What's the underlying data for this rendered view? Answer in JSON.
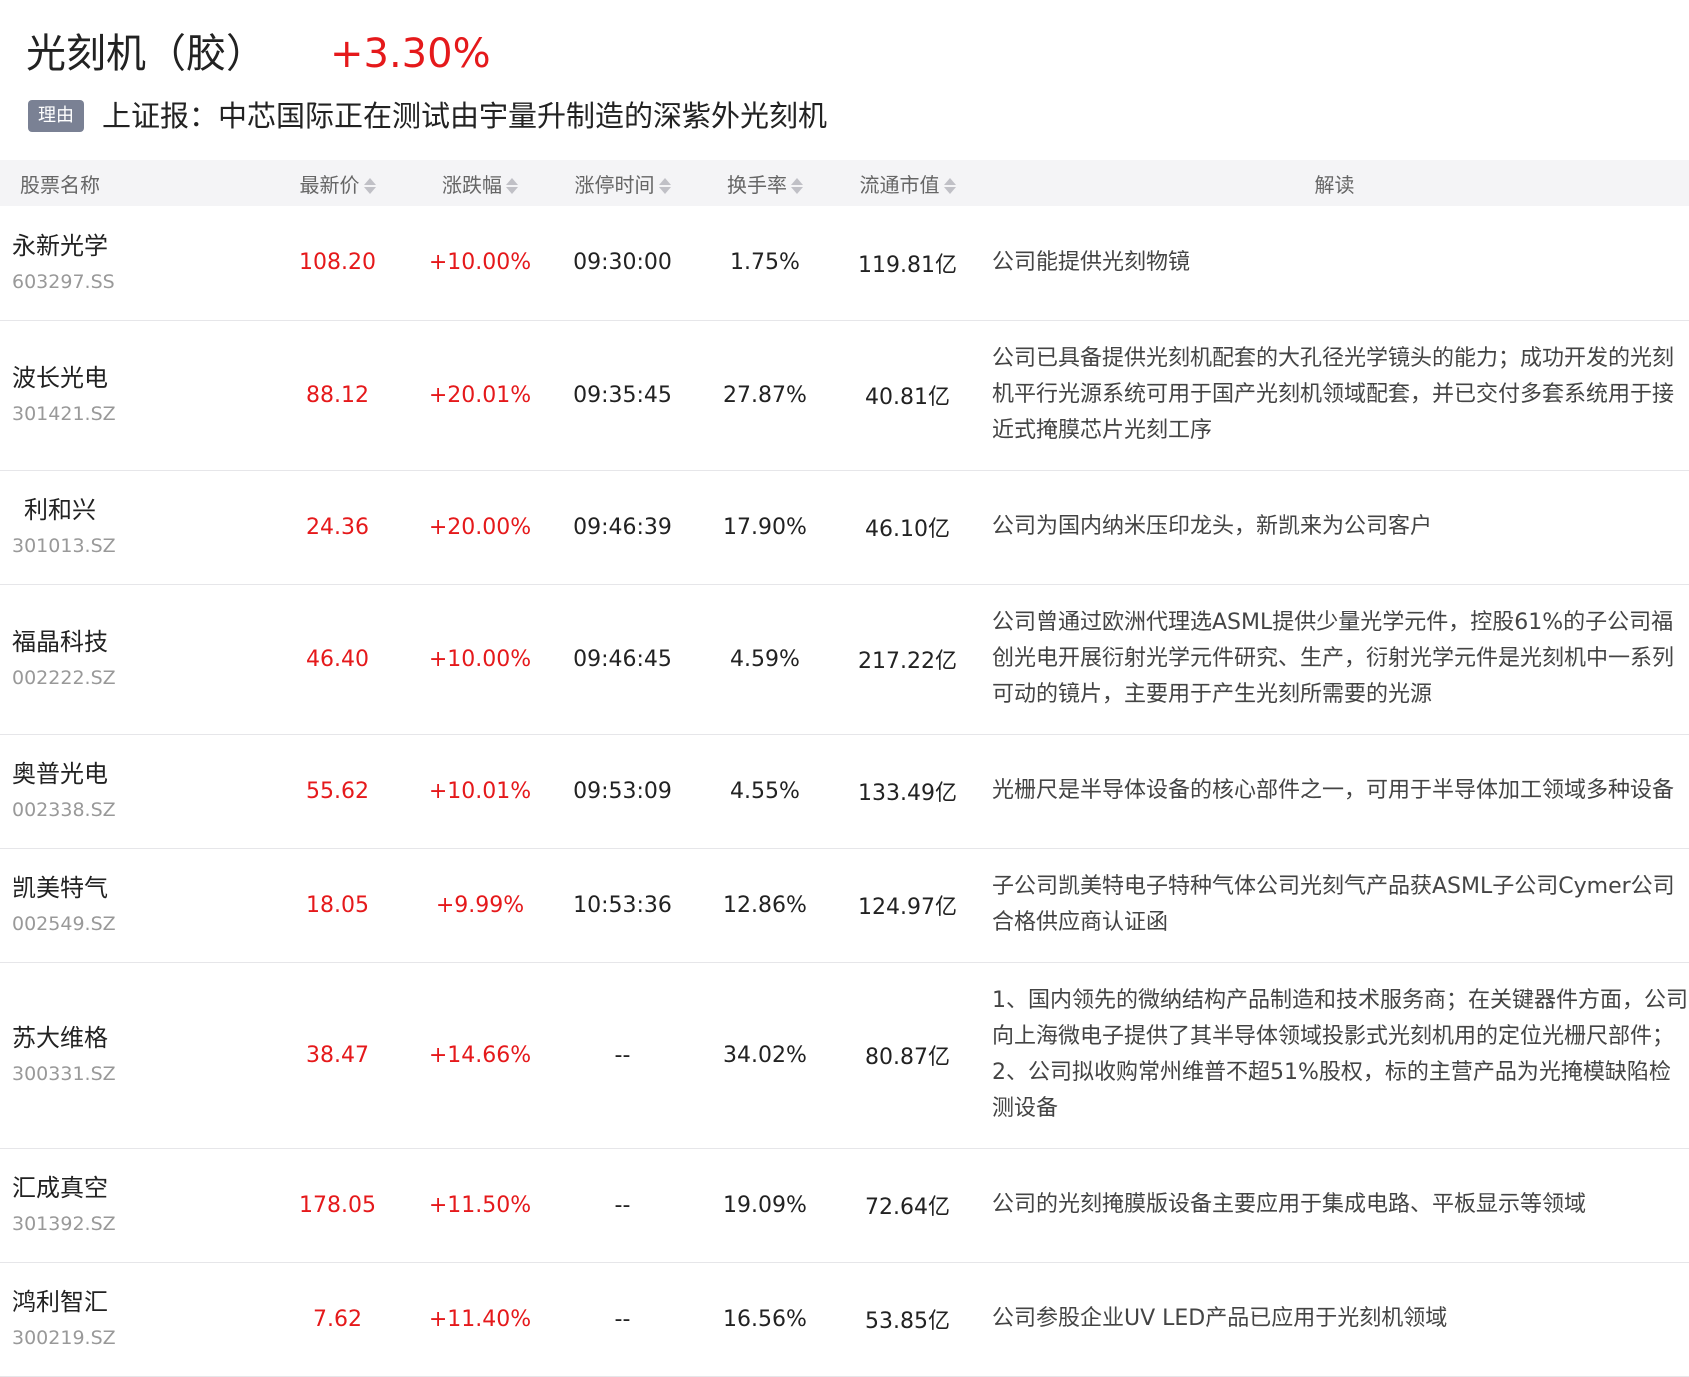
{
  "header": {
    "title": "光刻机（胶）",
    "change": "+3.30%",
    "reason_badge": "理由",
    "reason_text": "上证报：中芯国际正在测试由宇量升制造的深紫外光刻机"
  },
  "table": {
    "columns": {
      "name": "股票名称",
      "price": "最新价",
      "pct": "涨跌幅",
      "limit_time": "涨停时间",
      "turnover": "换手率",
      "mcap": "流通市值",
      "interp": "解读"
    },
    "rows": [
      {
        "name": "永新光学",
        "code": "603297.SS",
        "price": "108.20",
        "pct": "+10.00%",
        "time": "09:30:00",
        "turnover": "1.75%",
        "mcap": "119.81亿",
        "interp": "公司能提供光刻物镜"
      },
      {
        "name": "波长光电",
        "code": "301421.SZ",
        "price": "88.12",
        "pct": "+20.01%",
        "time": "09:35:45",
        "turnover": "27.87%",
        "mcap": "40.81亿",
        "interp": "公司已具备提供光刻机配套的大孔径光学镜头的能力；成功开发的光刻机平行光源系统可用于国产光刻机领域配套，并已交付多套系统用于接近式掩膜芯片光刻工序"
      },
      {
        "name": "利和兴",
        "code": "301013.SZ",
        "price": "24.36",
        "pct": "+20.00%",
        "time": "09:46:39",
        "turnover": "17.90%",
        "mcap": "46.10亿",
        "interp": "公司为国内纳米压印龙头，新凯来为公司客户"
      },
      {
        "name": "福晶科技",
        "code": "002222.SZ",
        "price": "46.40",
        "pct": "+10.00%",
        "time": "09:46:45",
        "turnover": "4.59%",
        "mcap": "217.22亿",
        "interp": "公司曾通过欧洲代理选ASML提供少量光学元件，控股61%的子公司福创光电开展衍射光学元件研究、生产，衍射光学元件是光刻机中一系列可动的镜片，主要用于产生光刻所需要的光源"
      },
      {
        "name": "奥普光电",
        "code": "002338.SZ",
        "price": "55.62",
        "pct": "+10.01%",
        "time": "09:53:09",
        "turnover": "4.55%",
        "mcap": "133.49亿",
        "interp": "光栅尺是半导体设备的核心部件之一，可用于半导体加工领域多种设备"
      },
      {
        "name": "凯美特气",
        "code": "002549.SZ",
        "price": "18.05",
        "pct": "+9.99%",
        "time": "10:53:36",
        "turnover": "12.86%",
        "mcap": "124.97亿",
        "interp": "子公司凯美特电子特种气体公司光刻气产品获ASML子公司Cymer公司合格供应商认证函"
      },
      {
        "name": "苏大维格",
        "code": "300331.SZ",
        "price": "38.47",
        "pct": "+14.66%",
        "time": "--",
        "turnover": "34.02%",
        "mcap": "80.87亿",
        "interp": "1、国内领先的微纳结构产品制造和技术服务商；在关键器件方面，公司向上海微电子提供了其半导体领域投影式光刻机用的定位光栅尺部件； 2、公司拟收购常州维普不超51%股权，标的主营产品为光掩模缺陷检测设备"
      },
      {
        "name": "汇成真空",
        "code": "301392.SZ",
        "price": "178.05",
        "pct": "+11.50%",
        "time": "--",
        "turnover": "19.09%",
        "mcap": "72.64亿",
        "interp": "公司的光刻掩膜版设备主要应用于集成电路、平板显示等领域"
      },
      {
        "name": "鸿利智汇",
        "code": "300219.SZ",
        "price": "7.62",
        "pct": "+11.40%",
        "time": "--",
        "turnover": "16.56%",
        "mcap": "53.85亿",
        "interp": "公司参股企业UV LED产品已应用于光刻机领域"
      }
    ]
  },
  "colors": {
    "rise": "#e5191b",
    "badge": "#7a8194",
    "header_bg": "#f4f4f6"
  },
  "icons": {
    "sort": "sort-up-down-icon"
  }
}
